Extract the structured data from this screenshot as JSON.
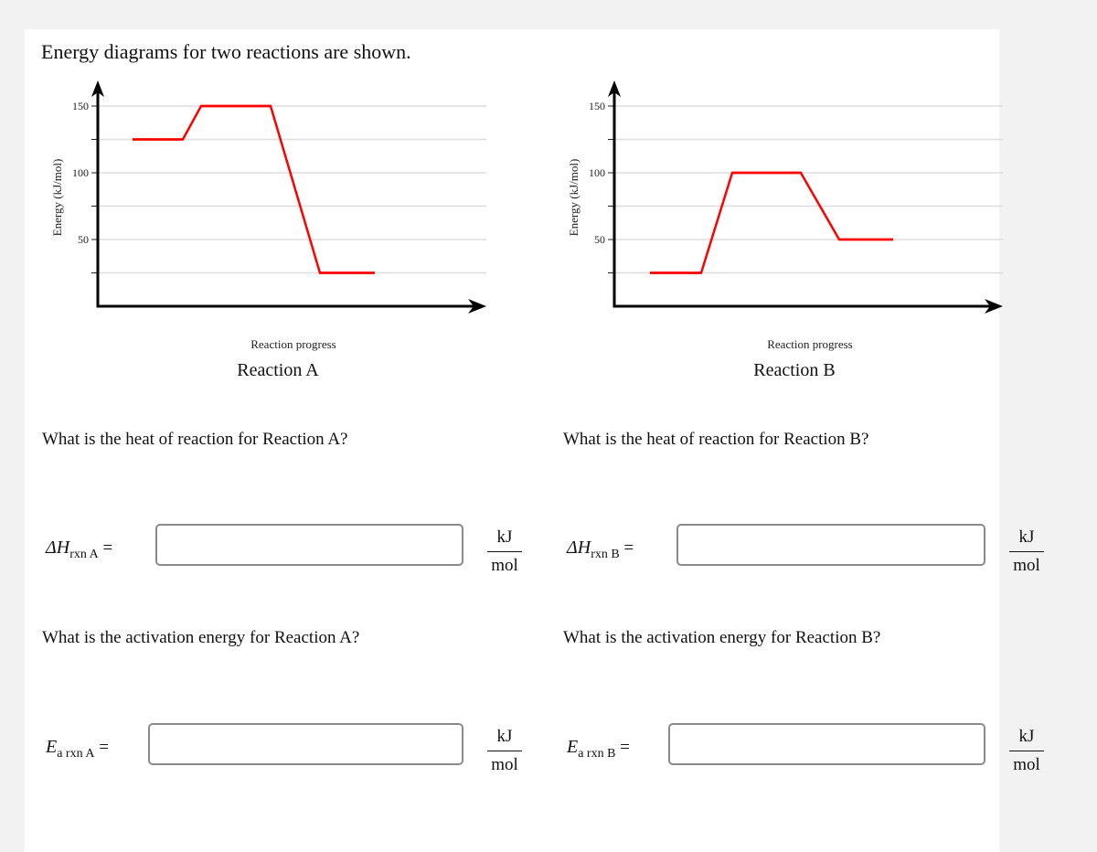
{
  "title": "Energy diagrams for two reactions are shown.",
  "chart_data": [
    {
      "type": "line",
      "title": "Reaction A",
      "xlabel": "Reaction progress",
      "ylabel": "Energy (kJ/mol)",
      "ylim": [
        0,
        160
      ],
      "yticks": [
        25,
        50,
        75,
        100,
        125,
        150
      ],
      "ytick_labels": [
        "50",
        "100",
        "150"
      ],
      "grid": true,
      "levels": {
        "reactants": 125,
        "transition_state": 150,
        "products": 25
      },
      "color": "#ff0000"
    },
    {
      "type": "line",
      "title": "Reaction B",
      "xlabel": "Reaction progress",
      "ylabel": "Energy (kJ/mol)",
      "ylim": [
        0,
        160
      ],
      "yticks": [
        25,
        50,
        75,
        100,
        125,
        150
      ],
      "ytick_labels": [
        "50",
        "100",
        "150"
      ],
      "grid": true,
      "levels": {
        "reactants": 25,
        "transition_state": 100,
        "products": 50
      },
      "color": "#ff0000"
    }
  ],
  "questions": {
    "heat_a": {
      "prompt": "What is the heat of reaction for Reaction A?",
      "symbol": "ΔH",
      "sub": "rxn A",
      "eq": "=",
      "value": "",
      "unit_num": "kJ",
      "unit_den": "mol"
    },
    "heat_b": {
      "prompt": "What is the heat of reaction for Reaction B?",
      "symbol": "ΔH",
      "sub": "rxn B",
      "eq": "=",
      "value": "",
      "unit_num": "kJ",
      "unit_den": "mol"
    },
    "ea_a": {
      "prompt": "What is the activation energy for Reaction A?",
      "symbol": "E",
      "sub": "a rxn A",
      "eq": "=",
      "value": "",
      "unit_num": "kJ",
      "unit_den": "mol"
    },
    "ea_b": {
      "prompt": "What is the activation energy for Reaction B?",
      "symbol": "E",
      "sub": "a rxn B",
      "eq": "=",
      "value": "",
      "unit_num": "kJ",
      "unit_den": "mol"
    }
  }
}
